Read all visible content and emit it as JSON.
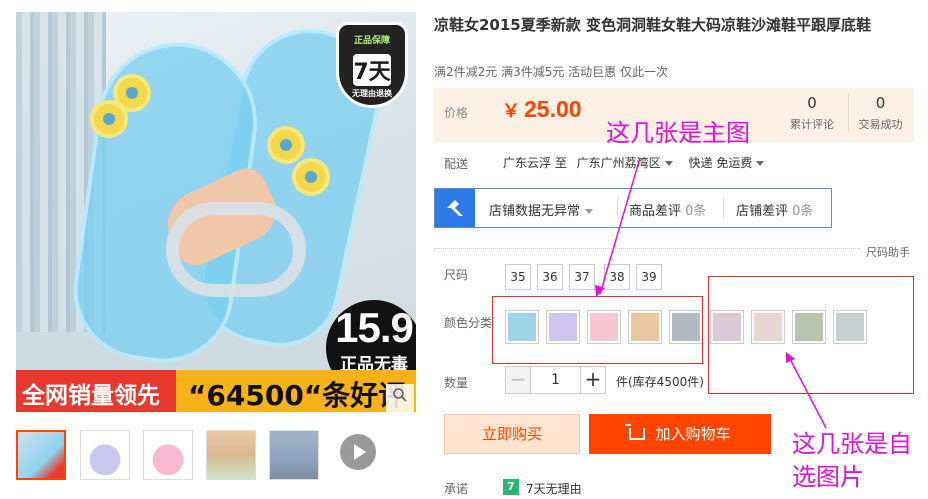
{
  "main_image": {
    "shield": {
      "line1": "正品保障",
      "line2": "7天",
      "line3": "无理由退换"
    },
    "price_badge": {
      "big": "15.9",
      "small": "正品无毒"
    },
    "banner": {
      "left": "全网销量领先",
      "right": "“64500“条好评"
    },
    "zoom_icon": "magnifier-icon"
  },
  "thumbnails": [
    {
      "color": "#8fd3ef",
      "selected": true
    },
    {
      "color": "#c9c7ef",
      "selected": false
    },
    {
      "color": "#f6b9cf",
      "selected": false
    },
    {
      "color": "#e9c9a7",
      "selected": false
    },
    {
      "color": "#9fb4c7",
      "selected": false
    }
  ],
  "product": {
    "title": "凉鞋女2015夏季新款 变色洞洞鞋女鞋大码凉鞋沙滩鞋平跟厚底鞋",
    "promo": "满2件减2元 满3件减5元 活动巨惠 仅此一次",
    "price_label": "价格",
    "currency": "￥",
    "price": "25.00",
    "stats": [
      {
        "num": "0",
        "label": "累计评论"
      },
      {
        "num": "0",
        "label": "交易成功"
      }
    ]
  },
  "shipping": {
    "label": "配送",
    "from": "广东云浮 至",
    "to": "广东广州荔湾区",
    "express": "快递 免运费"
  },
  "store": {
    "status": "店铺数据无异常",
    "goods_bad_label": "商品差评",
    "goods_bad_value": "0条",
    "store_bad_label": "店铺差评",
    "store_bad_value": "0条"
  },
  "size_help": "尺码助手",
  "size": {
    "label": "尺码",
    "options": [
      "35",
      "36",
      "37",
      "38",
      "39"
    ]
  },
  "color": {
    "label": "颜色分类",
    "swatches": [
      "#9fd4e6",
      "#cfc6ef",
      "#f7c7d6",
      "#e8c6a1",
      "#b5b9c3",
      "#dbc9d6",
      "#e6d5d2",
      "#b8c4b1",
      "#c4d1cf"
    ]
  },
  "quantity": {
    "label": "数量",
    "minus": "−",
    "value": "1",
    "plus": "+",
    "stock": "件(库存4500件)"
  },
  "buttons": {
    "buy": "立即购买",
    "cart": "加入购物车"
  },
  "promise": {
    "label": "承诺",
    "icon_text": "7",
    "text": "7天无理由"
  },
  "annotations": {
    "main_note": "这几张是主图",
    "custom_note_1": "这几张是自",
    "custom_note_2": "选图片",
    "color": "#e012d9"
  }
}
